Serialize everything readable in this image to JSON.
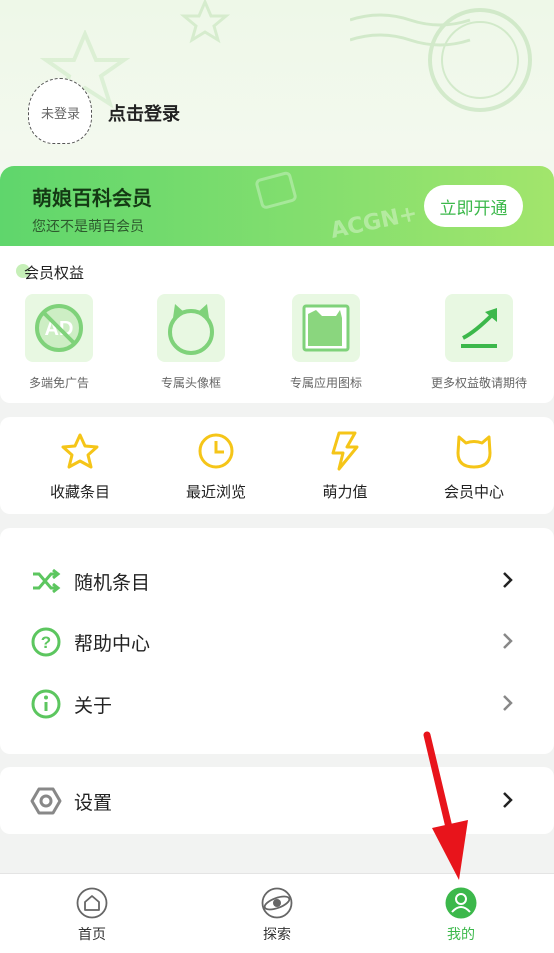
{
  "header": {
    "avatar_placeholder": "未登录",
    "login_label": "点击登录"
  },
  "member_card": {
    "title": "萌娘百科会员",
    "subtitle": "您还不是萌百会员",
    "join_button": "立即开通",
    "watermark": "ACGN+"
  },
  "benefits": {
    "title": "会员权益",
    "items": [
      {
        "label": "多端免广告",
        "icon": "no-ads-icon"
      },
      {
        "label": "专属头像框",
        "icon": "avatar-frame-icon"
      },
      {
        "label": "专属应用图标",
        "icon": "app-icon"
      },
      {
        "label": "更多权益敬请期待",
        "icon": "trend-up-icon"
      }
    ]
  },
  "quick_actions": [
    {
      "label": "收藏条目",
      "icon": "star-icon"
    },
    {
      "label": "最近浏览",
      "icon": "clock-icon"
    },
    {
      "label": "萌力值",
      "icon": "lightning-icon"
    },
    {
      "label": "会员中心",
      "icon": "cat-icon"
    }
  ],
  "menu": [
    {
      "label": "随机条目",
      "icon": "shuffle-icon"
    },
    {
      "label": "帮助中心",
      "icon": "help-icon"
    },
    {
      "label": "关于",
      "icon": "info-icon"
    }
  ],
  "settings": {
    "label": "设置",
    "icon": "settings-icon"
  },
  "tabbar": [
    {
      "label": "首页",
      "icon": "home-icon"
    },
    {
      "label": "探索",
      "icon": "explore-icon"
    },
    {
      "label": "我的",
      "icon": "profile-icon",
      "active": true
    }
  ],
  "colors": {
    "accent": "#3cb84b",
    "card_start": "#5fd66c",
    "card_end": "#a2e56c",
    "icon_green": "#5cc65f",
    "icon_yellow": "#f5c518",
    "annotation_red": "#e8141b"
  }
}
